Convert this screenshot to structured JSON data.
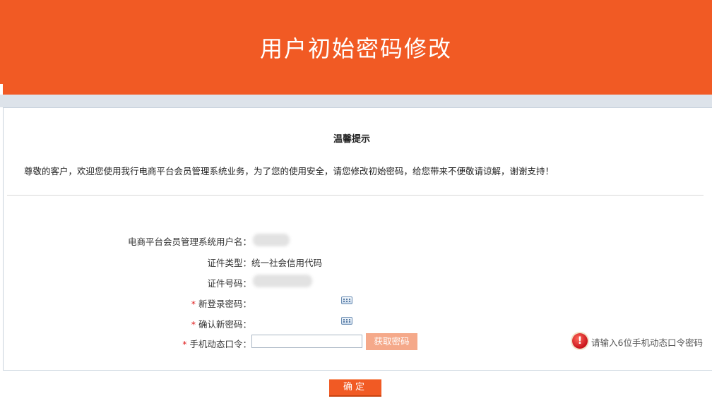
{
  "header": {
    "title": "用户初始密码修改"
  },
  "tips": {
    "title": "温馨提示",
    "message": "尊敬的客户，欢迎您使用我行电商平台会员管理系统业务，为了您的使用安全，请您修改初始密码，给您带来不便敬请谅解，谢谢支持！"
  },
  "form": {
    "username_label": "电商平台会员管理系统用户名：",
    "id_type_label": "证件类型：",
    "id_type_value": "统一社会信用代码",
    "id_number_label": "证件号码：",
    "required_mark": "*",
    "new_password_label": "新登录密码：",
    "confirm_password_label": "确认新密码：",
    "otp_label": "手机动态口令：",
    "otp_value": "",
    "get_code_button": "获取密码",
    "otp_hint": "请输入6位手机动态口令密码"
  },
  "actions": {
    "confirm_label": "确定"
  },
  "colors": {
    "brand": "#f15a24",
    "get_code_button": "#f5a98a",
    "required": "#e02020"
  }
}
